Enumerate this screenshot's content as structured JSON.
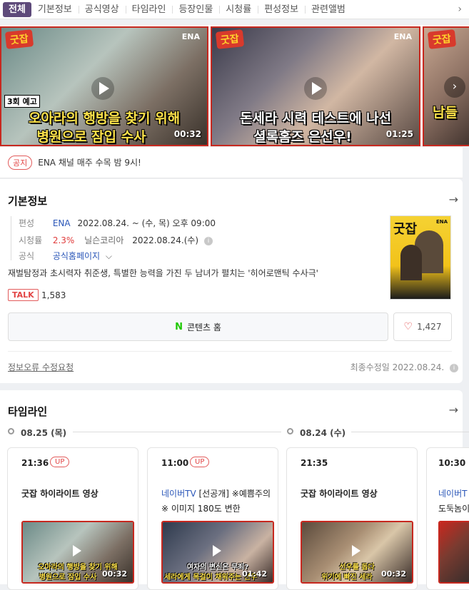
{
  "tabs": [
    "전체",
    "기본정보",
    "공식영상",
    "타임라인",
    "등장인물",
    "시청률",
    "편성정보",
    "관련앨범"
  ],
  "videos": [
    {
      "episode": "3회 예고",
      "line1": "오아라의 행방을 찾기 위해",
      "line2": "병원으로 잠입 수사",
      "duration": "00:32"
    },
    {
      "line1": "돈세라 시력 테스트에 나선",
      "line2": "셜록홈즈 은선우!",
      "duration": "01:25"
    },
    {
      "line1": "남들",
      "line2": ""
    }
  ],
  "notice": {
    "badge": "공지",
    "text": "ENA 채널 매주 수목 밤 9시!"
  },
  "basic_info": {
    "title": "기본정보",
    "broadcast_label": "편성",
    "channel": "ENA",
    "schedule": "2022.08.24. ~  (수, 목) 오후 09:00",
    "rating_label": "시청률",
    "rating": "2.3%",
    "rating_source": "닐슨코리아",
    "rating_date": "2022.08.24.(수)",
    "official_label": "공식",
    "official_link": "공식홈페이지",
    "description": "재벌탐정과 초시력자 취준생, 특별한 능력을 가진 두 남녀가 펼치는 '히어로맨틱 수사극'",
    "talk_label": "TALK",
    "talk_count": "1,583",
    "poster_title": "굿잡",
    "poster_channel": "ENA",
    "home_button": "콘텐츠 홈",
    "home_icon": "N",
    "like_count": "1,427",
    "report_link": "정보오류 수정요청",
    "updated": "최종수정일 2022.08.24."
  },
  "timeline": {
    "title": "타임라인",
    "dates": [
      "08.25 (목)",
      "08.24 (수)"
    ],
    "cards": [
      {
        "time": "21:36",
        "badge": "UP",
        "source": "",
        "text": "굿잡 하이라이트 영상",
        "cap1": "오아라의 행방을 찾기 위해",
        "cap2": "병원으로 잠입 수사",
        "duration": "00:32"
      },
      {
        "time": "11:00",
        "badge": "UP",
        "source": "네이버TV",
        "text": " [선공개] ※예쁨주의※ 이미지 180도 변한",
        "cap1": "여자의 변신은 무죄?",
        "cap2": "세라에게 목걸이 채워주는 선우",
        "duration": "01:42"
      },
      {
        "time": "21:35",
        "badge": "",
        "source": "",
        "text": "굿잡 하이라이트 영상",
        "cap1": "선우를 돕다",
        "cap2": "위기에 빠진 세라",
        "duration": "00:32"
      },
      {
        "time": "10:30",
        "badge": "",
        "source": "네이버T",
        "text": "도둑놈이",
        "cap1": "",
        "cap2": "",
        "duration": ""
      }
    ]
  }
}
